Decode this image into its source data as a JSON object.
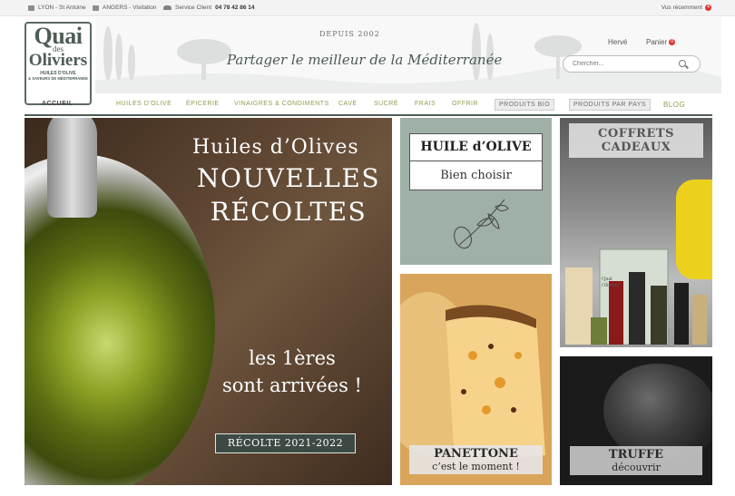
{
  "topbar": {
    "store1": "LYON - St Antoine",
    "store2": "ANGERS - Visitation",
    "service_label": "Service Client",
    "service_phone": "04 78 42 86 14",
    "recent_label": "Vus récemment",
    "recent_count": "4"
  },
  "logo": {
    "line1": "Quai",
    "line2": "des",
    "line3": "Oliviers",
    "line4": "HUILES D'OLIVE",
    "line5": "& SAVEURS DE MÉDITERRANÉE"
  },
  "header": {
    "since": "DEPUIS 2002",
    "tagline": "Partager le meilleur de la Méditerranée",
    "user": "Hervé",
    "cart_label": "Panier",
    "cart_count": "0",
    "search_placeholder": "Chercher..."
  },
  "nav": {
    "items": [
      "ACCUEIL",
      "HUILES D'OLIVE",
      "ÉPICERIE",
      "VINAIGRES & CONDIMENTS",
      "CAVE",
      "SUCRÉ",
      "FRAIS",
      "OFFRIR",
      "PRODUITS BIO",
      "PRODUITS PAR PAYS",
      "BLOG"
    ]
  },
  "banners": {
    "main": {
      "line1": "Huiles d’Olives",
      "line2": "NOUVELLES",
      "line3": "RÉCOLTES",
      "line4": "les 1ères",
      "line5": "sont arrivées !",
      "badge": "RÉCOLTE 2021-2022"
    },
    "huile": {
      "title": "HUILE d’OLIVE",
      "subtitle": "Bien choisir"
    },
    "coffrets": {
      "line1": "COFFRETS",
      "line2": "CADEAUX",
      "pack_label": "Quai Oliviers"
    },
    "panettone": {
      "title": "PANETTONE",
      "subtitle": "c’est le moment !"
    },
    "truffe": {
      "title": "TRUFFE",
      "subtitle": "découvrir"
    }
  },
  "colors": {
    "accent": "#8b9d4d",
    "dark": "#4f5c56",
    "badge": "#3d4a44"
  }
}
